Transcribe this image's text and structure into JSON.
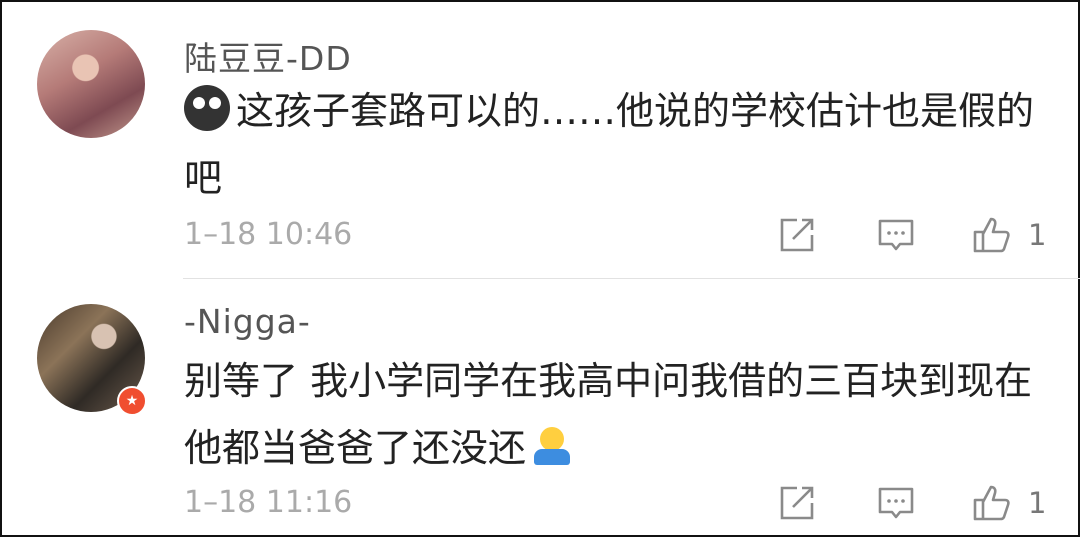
{
  "comments": [
    {
      "username": "陆豆豆-DD",
      "text": "这孩子套路可以的……他说的学校估计也是假的吧",
      "emoji_icon": "crying-face-emoji",
      "time": "1–18 10:46",
      "likes": "1"
    },
    {
      "username": "-Nigga-",
      "text": "别等了 我小学同学在我高中问我借的三百块到现在他都当爸爸了还没还",
      "emoji_icon": "shrug-emoji",
      "badge_icon": "verified-star-badge",
      "time": "1–18 11:16",
      "likes": "1"
    }
  ],
  "icons": {
    "share": "share-icon",
    "reply": "comment-icon",
    "like": "thumbs-up-icon"
  },
  "colors": {
    "badge": "#f04e30",
    "divider": "#e2e2e2",
    "meta_text": "#aaaaaa"
  }
}
